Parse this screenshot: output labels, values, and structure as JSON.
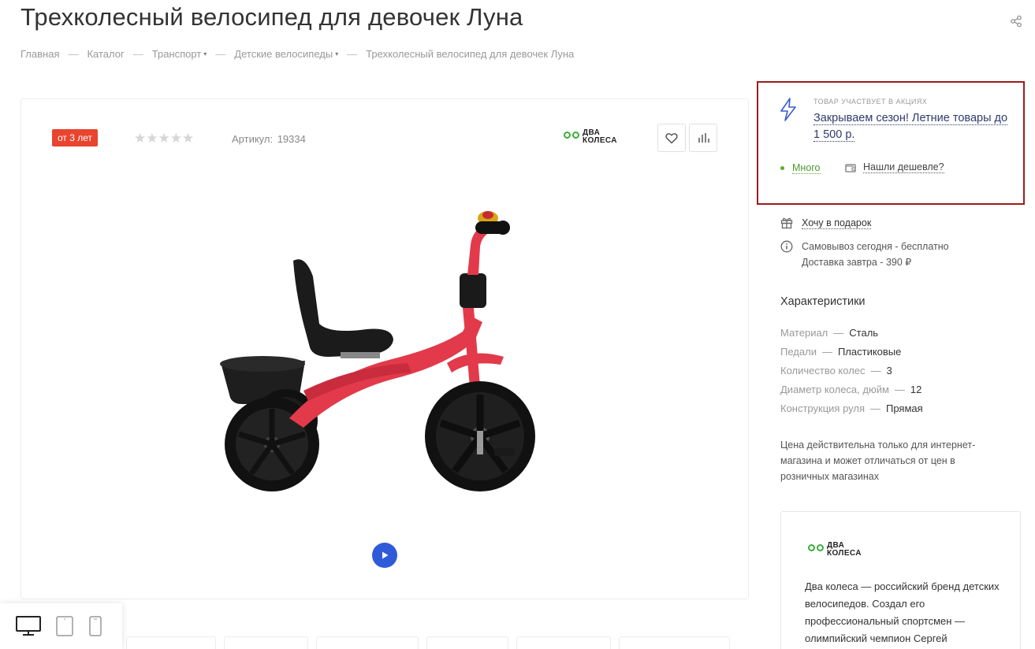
{
  "page": {
    "title": "Трехколесный велосипед для девочек Луна"
  },
  "breadcrumb": {
    "items": [
      {
        "label": "Главная"
      },
      {
        "label": "Каталог"
      },
      {
        "label": "Транспорт"
      },
      {
        "label": "Детские велосипеды"
      }
    ],
    "current": "Трехколесный велосипед для девочек Луна",
    "separator": "—",
    "caret": "▾"
  },
  "product": {
    "age_badge": "от 3 лет",
    "rating_stars": "★★★★★",
    "rating_value": 0,
    "article_label": "Артикул:",
    "article_value": "19334"
  },
  "brand": {
    "logo_line1": "ДВА",
    "logo_line2": "КОЛЕСА",
    "description": "Два колеса — российский бренд детских велосипедов. Создал его профессиональный спортсмен — олимпийский чемпион Сергей"
  },
  "promo": {
    "tag": "ТОВАР УЧАСТВУЕТ В АКЦИЯХ",
    "link": "Закрываем сезон! Летние товары до 1 500 р.",
    "stock": "Много",
    "cheaper": "Нашли дешевле?"
  },
  "gift": {
    "label": "Хочу в подарок"
  },
  "delivery": {
    "pickup": "Самовывоз сегодня - бесплатно",
    "delivery": "Доставка завтра - 390 ₽"
  },
  "characteristics": {
    "title": "Характеристики",
    "dash": "—",
    "items": [
      {
        "name": "Материал",
        "value": "Сталь"
      },
      {
        "name": "Педали",
        "value": "Пластиковые"
      },
      {
        "name": "Количество колес",
        "value": "3"
      },
      {
        "name": "Диаметр колеса, дюйм",
        "value": "12"
      },
      {
        "name": "Конструкция руля",
        "value": "Прямая"
      }
    ]
  },
  "price_note": "Цена действительна только для интернет-магазина и может отличаться от цен в розничных магазинах",
  "colors": {
    "badge": "#e8442f",
    "promo_border": "#9b1c1c",
    "promo_link": "#2f3b6c",
    "stock_green": "#5cae2a",
    "play_blue": "#2f5bd8",
    "logo_green": "#3aae3a"
  },
  "icons": {
    "share": "share-icon",
    "favorite": "heart-icon",
    "compare": "bar-chart-icon",
    "play": "play-icon",
    "promo": "lightning-icon",
    "cheaper": "wallet-icon",
    "gift": "gift-icon",
    "info": "info-icon",
    "desktop": "desktop-icon",
    "tablet": "tablet-icon",
    "mobile": "mobile-icon"
  }
}
